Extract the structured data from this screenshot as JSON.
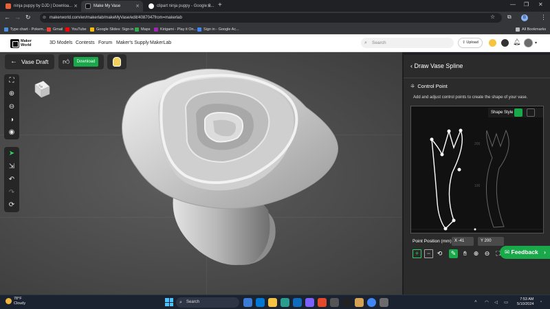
{
  "browser": {
    "tabs": [
      {
        "title": "ninja puppy by DJD | Downloa...",
        "active": false
      },
      {
        "title": "Make My Vase",
        "active": true
      },
      {
        "title": "clipart ninja puppy - Google S...",
        "active": false
      }
    ],
    "url": "makerworld.com/en/makerlab/makeMyVase/edit/4087047from=makerlab",
    "bookmarks": [
      "Type chart - Pokem...",
      "Gmail",
      "YouTube",
      "Google Slides: Sign-in",
      "Maps",
      "Kirigami - Play it On...",
      "Sign in - Google Ac..."
    ],
    "all_bookmarks_label": "All Bookmarks",
    "profile_letter": "B"
  },
  "site": {
    "logo_line1": "Maker",
    "logo_line2": "World",
    "menu": [
      "3D Models",
      "Contests",
      "Forum",
      "Maker's Supply",
      "MakerLab"
    ],
    "search_placeholder": "Search",
    "upload_label": "Upload"
  },
  "editor": {
    "back_label": "Vase Draft",
    "download_label": "Download",
    "cube_label": "Top"
  },
  "panel": {
    "title": "Draw Vase Spline",
    "section_title": "Control Point",
    "description": "Add and adjust control points to create the shape of your vase.",
    "shape_style_label": "Shape Style",
    "axis_labels": [
      "200",
      "100"
    ],
    "point_position_label": "Point Position (mm)",
    "x_value": "X -41",
    "y_value": "Y 200"
  },
  "feedback_label": "Feedback",
  "taskbar": {
    "temperature": "78°F",
    "weather": "Cloudy",
    "search_label": "Search",
    "time": "7:53 AM",
    "date": "5/10/2024"
  },
  "colors": {
    "accent_green": "#19a84a",
    "panel_bg": "#2b2b2b",
    "viewport_bg": "#4f4f4f"
  }
}
